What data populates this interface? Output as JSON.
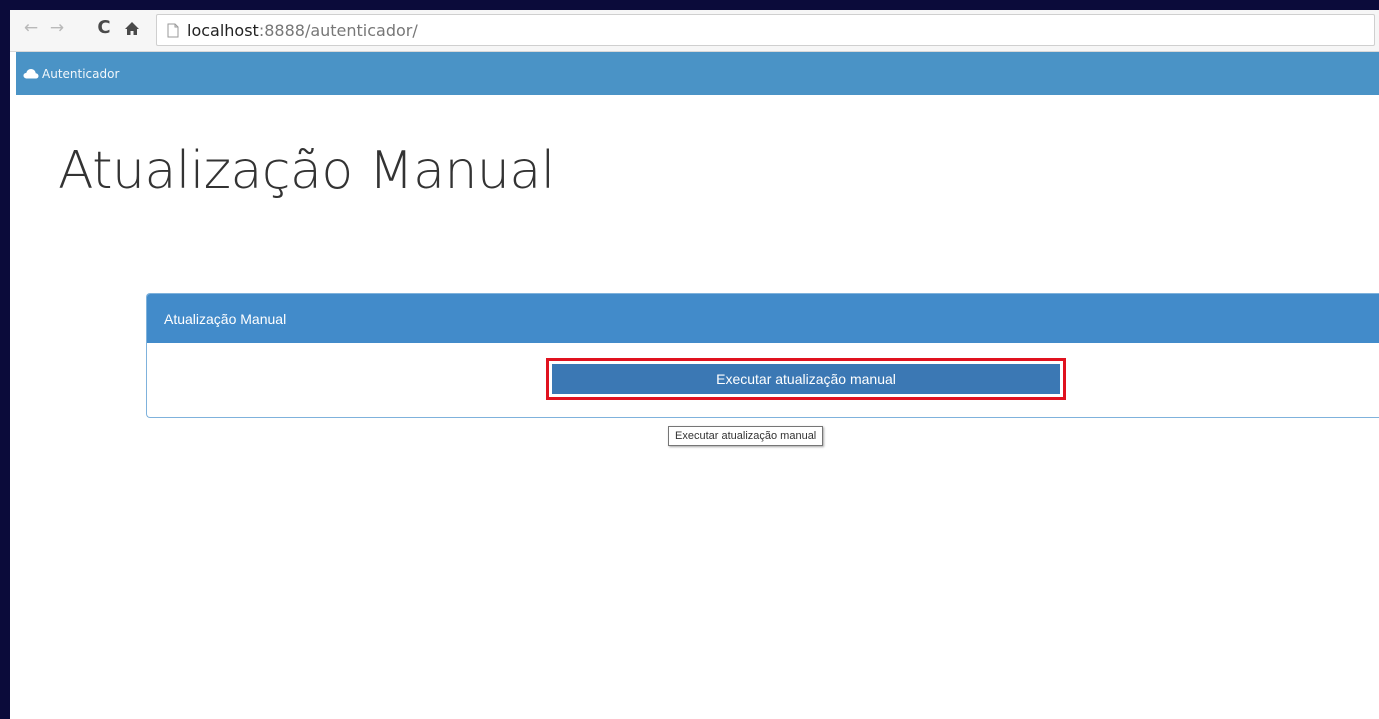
{
  "browser": {
    "url_host": "localhost",
    "url_rest": ":8888/autenticador/"
  },
  "navbar": {
    "brand": "Autenticador",
    "brand_icon": "cloud-icon"
  },
  "page": {
    "title": "Atualização Manual"
  },
  "panel": {
    "heading": "Atualização Manual",
    "button_label": "Executar atualização manual",
    "tooltip": "Executar atualização manual"
  },
  "colors": {
    "navbar": "#4a93c6",
    "panel_heading": "#428bca",
    "button": "#3b78b4",
    "highlight_border": "#e0121f"
  }
}
